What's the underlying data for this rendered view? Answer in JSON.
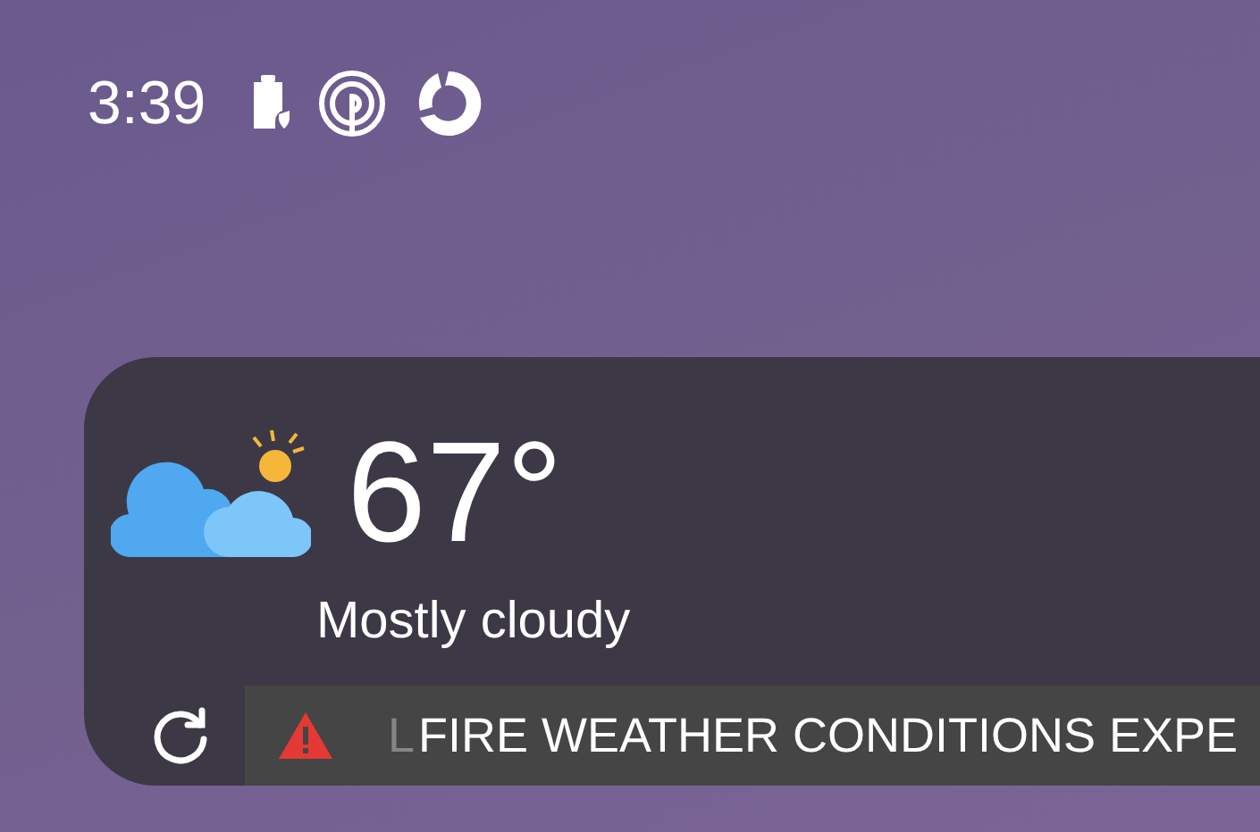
{
  "status_bar": {
    "time": "3:39"
  },
  "weather": {
    "temperature": "67°",
    "condition": "Mostly cloudy"
  },
  "alert": {
    "faded_text": "L",
    "text": "FIRE WEATHER CONDITIONS EXPE"
  }
}
